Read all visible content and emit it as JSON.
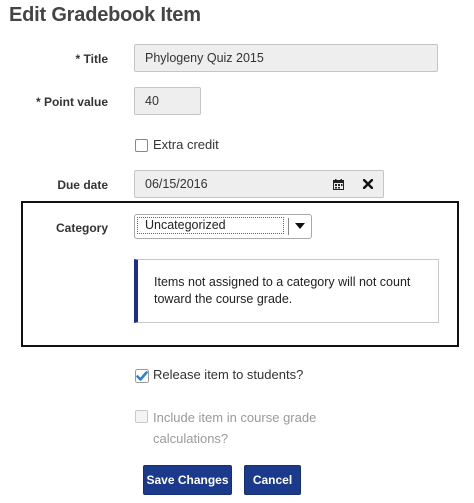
{
  "page": {
    "heading": "Edit Gradebook Item"
  },
  "form": {
    "title": {
      "label": "* Title",
      "value": "Phylogeny Quiz 2015"
    },
    "points": {
      "label": "* Point value",
      "value": "40"
    },
    "extra_credit": {
      "label": "Extra credit",
      "checked": false
    },
    "due_date": {
      "label": "Due date",
      "value": "06/15/2016"
    },
    "category": {
      "label": "Category",
      "selected": "Uncategorized",
      "info": "Items not assigned to a category will not count toward the course grade."
    },
    "release": {
      "label": "Release item to students?",
      "checked": true
    },
    "include": {
      "label": "Include item in course grade calculations?",
      "checked": false,
      "disabled": true
    }
  },
  "actions": {
    "save": "Save Changes",
    "cancel": "Cancel"
  },
  "colors": {
    "primary": "#1b3a8c",
    "check": "#2d7fd0",
    "callout_border": "#111111"
  }
}
